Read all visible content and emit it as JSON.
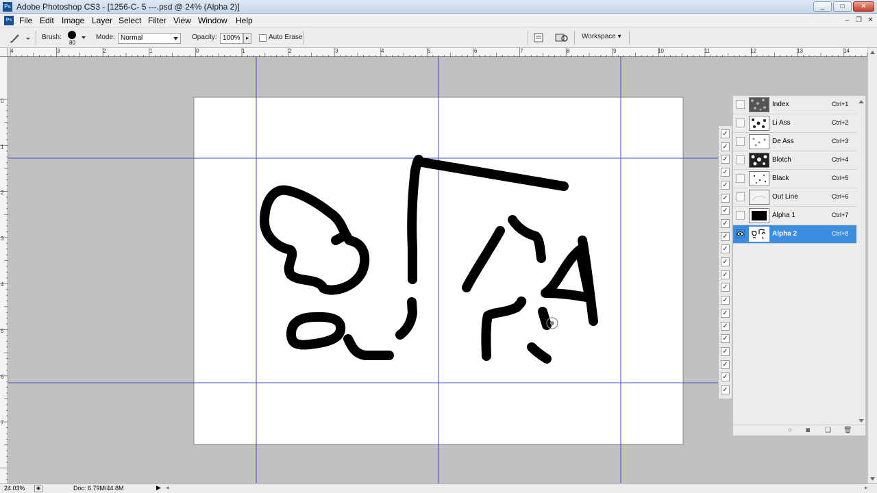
{
  "window": {
    "title": "Adobe Photoshop CS3 - [1256-C- 5 ---.psd @ 24% (Alpha 2)]",
    "logo": "Ps"
  },
  "menu": [
    "File",
    "Edit",
    "Image",
    "Layer",
    "Select",
    "Filter",
    "View",
    "Window",
    "Help"
  ],
  "options": {
    "brush_label": "Brush:",
    "brush_size": "80",
    "mode_label": "Mode:",
    "mode_value": "Normal",
    "opacity_label": "Opacity:",
    "opacity_value": "100%",
    "auto_erase_label": "Auto Erase",
    "workspace_label": "Workspace ▾"
  },
  "rulers": {
    "h_ticks": [
      "4",
      "3",
      "2",
      "1",
      "0",
      "1",
      "2",
      "3",
      "4",
      "5",
      "6",
      "7",
      "8",
      "9",
      "10",
      "11",
      "12",
      "13",
      "14"
    ],
    "v_ticks": [
      "0",
      "1",
      "2",
      "3",
      "4",
      "5",
      "6",
      "7"
    ]
  },
  "status": {
    "zoom": "24.03%",
    "doc": "Doc: 6.79M/44.8M"
  },
  "channels": [
    {
      "name": "Index",
      "shortcut": "Ctrl+1",
      "selected": false,
      "thumb": "noise"
    },
    {
      "name": "Li Ass",
      "shortcut": "Ctrl+2",
      "selected": false,
      "thumb": "dots"
    },
    {
      "name": "De Ass",
      "shortcut": "Ctrl+3",
      "selected": false,
      "thumb": "light-dots"
    },
    {
      "name": "Blotch",
      "shortcut": "Ctrl+4",
      "selected": false,
      "thumb": "blotch"
    },
    {
      "name": "Black",
      "shortcut": "Ctrl+5",
      "selected": false,
      "thumb": "speck"
    },
    {
      "name": "Out Line",
      "shortcut": "Ctrl+6",
      "selected": false,
      "thumb": "pale"
    },
    {
      "name": "Alpha 1",
      "shortcut": "Ctrl+7",
      "selected": false,
      "thumb": "black"
    },
    {
      "name": "Alpha 2",
      "shortcut": "Ctrl+8",
      "selected": true,
      "thumb": "sketch"
    }
  ],
  "colors": {
    "selection": "#3b8de0",
    "guide": "#4a4ac8",
    "workspace": "#c0c0c0"
  }
}
